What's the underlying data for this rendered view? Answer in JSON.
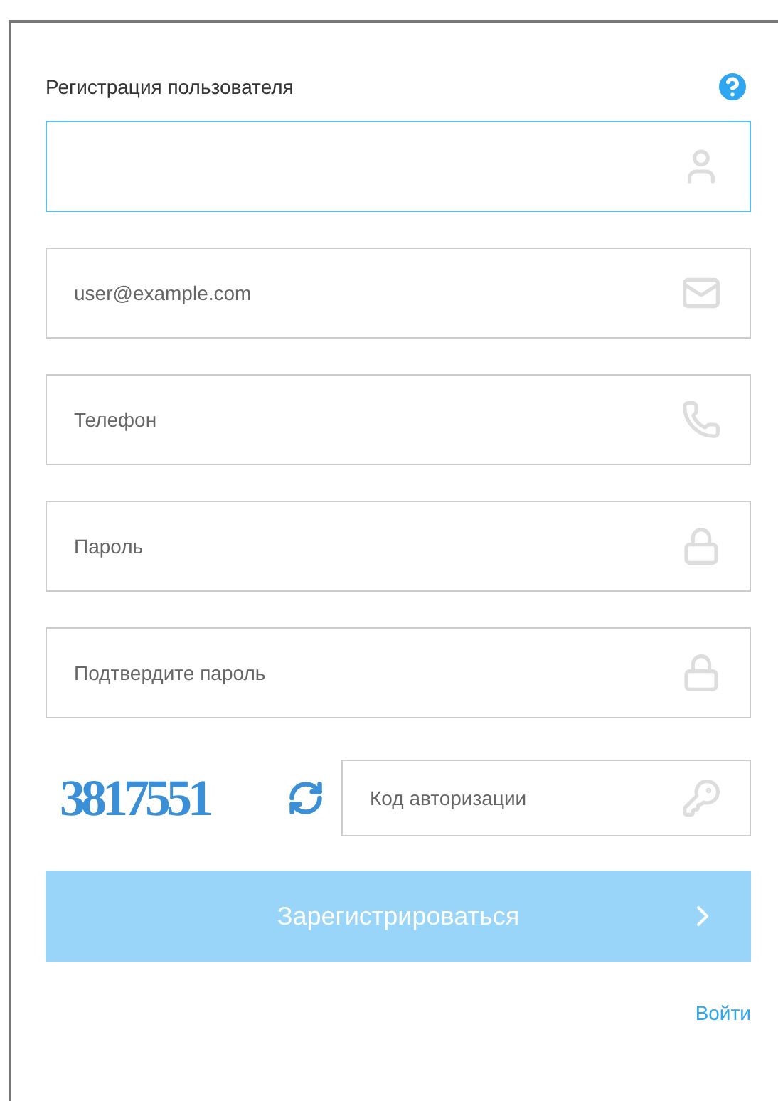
{
  "title": "Регистрация пользователя",
  "fields": [
    {
      "kind": "user",
      "focused": true
    },
    {
      "kind": "email",
      "placeholder": "user@example.com",
      "focused": false
    },
    {
      "kind": "phone",
      "placeholder": "Телефон",
      "focused": false
    },
    {
      "kind": "password",
      "placeholder": "Пароль",
      "focused": false
    },
    {
      "kind": "password",
      "placeholder": "Подтвердите пароль",
      "focused": false
    }
  ],
  "captcha": {
    "code": "3817551",
    "field": {
      "kind": "code",
      "placeholder": "Код авторизации",
      "focused": false
    }
  },
  "submit": {
    "label": "Зарегистрироваться",
    "disabled": true
  },
  "login_link": "Войти"
}
